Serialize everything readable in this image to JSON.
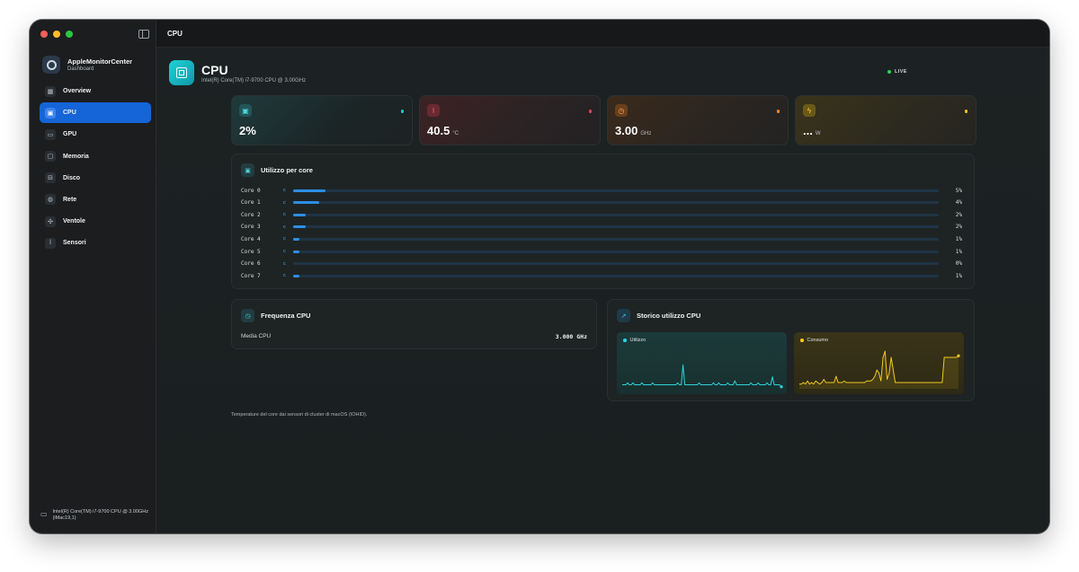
{
  "app": {
    "name": "AppleMonitorCenter",
    "subtitle": "Dashboard"
  },
  "sidebar": {
    "items": [
      {
        "label": "Overview",
        "icon": "grid-icon",
        "glyph": "▦",
        "active": false
      },
      {
        "label": "CPU",
        "icon": "chip-icon",
        "glyph": "▣",
        "active": true
      },
      {
        "label": "GPU",
        "icon": "display-icon",
        "glyph": "▭",
        "active": false
      },
      {
        "label": "Memoria",
        "icon": "memory-icon",
        "glyph": "▢",
        "active": false
      },
      {
        "label": "Disco",
        "icon": "disk-icon",
        "glyph": "⊟",
        "active": false
      },
      {
        "label": "Rete",
        "icon": "globe-icon",
        "glyph": "◍",
        "active": false
      },
      {
        "label": "Ventole",
        "icon": "fan-icon",
        "glyph": "✣",
        "active": false
      },
      {
        "label": "Sensori",
        "icon": "thermometer-icon",
        "glyph": "ǀ",
        "active": false
      }
    ],
    "footer": "Intel(R) Core(TM) i7-9700 CPU @ 3.00GHz (iMac19,1)"
  },
  "titlebar": {
    "title": "CPU"
  },
  "header": {
    "title": "CPU",
    "subtitle": "Intel(R) Core(TM) i7-9700 CPU @ 3.00GHz",
    "live": "LIVE"
  },
  "stats": [
    {
      "value": "2%",
      "unit": "",
      "icon": "chip-icon",
      "color": "#27c3c9"
    },
    {
      "value": "40.5",
      "unit": "°C",
      "icon": "thermometer-icon",
      "color": "#e8414f"
    },
    {
      "value": "3.00",
      "unit": "GHz",
      "icon": "clock-icon",
      "color": "#f08a2a"
    },
    {
      "value": "...",
      "unit": "W",
      "icon": "bolt-icon",
      "color": "#f2c21b"
    }
  ],
  "cores": {
    "title": "Utilizzo per core",
    "rows": [
      {
        "label": "Core 0",
        "marker": "c",
        "pct": 5,
        "text": "5%"
      },
      {
        "label": "Core 1",
        "marker": "c",
        "pct": 4,
        "text": "4%"
      },
      {
        "label": "Core 2",
        "marker": "c",
        "pct": 2,
        "text": "2%"
      },
      {
        "label": "Core 3",
        "marker": "c",
        "pct": 2,
        "text": "2%"
      },
      {
        "label": "Core 4",
        "marker": "c",
        "pct": 1,
        "text": "1%"
      },
      {
        "label": "Core 5",
        "marker": "c",
        "pct": 1,
        "text": "1%"
      },
      {
        "label": "Core 6",
        "marker": "c",
        "pct": 0,
        "text": "0%"
      },
      {
        "label": "Core 7",
        "marker": "c",
        "pct": 1,
        "text": "1%"
      }
    ]
  },
  "frequency": {
    "title": "Frequenza CPU",
    "label": "Media CPU",
    "value": "3.000 GHz"
  },
  "history": {
    "title": "Storico utilizzo CPU",
    "usage_label": "Utilizzo",
    "power_label": "Consumo",
    "usage_color": "#2ed3da",
    "power_color": "#f2c91f",
    "usage_series": [
      2,
      2,
      2,
      3,
      2,
      2,
      3,
      2,
      2,
      2,
      2,
      3,
      2,
      2,
      2,
      2,
      2,
      3,
      2,
      2,
      2,
      2,
      2,
      2,
      2,
      2,
      2,
      2,
      2,
      2,
      2,
      3,
      2,
      2,
      12,
      2,
      2,
      2,
      2,
      2,
      2,
      2,
      2,
      3,
      2,
      2,
      2,
      2,
      2,
      2,
      2,
      3,
      2,
      2,
      3,
      2,
      2,
      2,
      2,
      3,
      2,
      2,
      2,
      4,
      2,
      2,
      2,
      2,
      2,
      2,
      2,
      2,
      3,
      2,
      2,
      2,
      3,
      2,
      2,
      2,
      2,
      3,
      2,
      2,
      6,
      2,
      2,
      2,
      2,
      1
    ],
    "power_series": [
      3,
      3,
      4,
      3,
      5,
      3,
      4,
      3,
      5,
      4,
      3,
      4,
      6,
      4,
      4,
      4,
      4,
      4,
      8,
      4,
      4,
      4,
      5,
      4,
      4,
      4,
      4,
      4,
      4,
      4,
      4,
      4,
      4,
      5,
      5,
      5,
      6,
      8,
      12,
      10,
      5,
      20,
      24,
      6,
      10,
      20,
      12,
      4,
      4,
      4,
      4,
      4,
      4,
      4,
      4,
      4,
      4,
      4,
      4,
      4,
      4,
      4,
      4,
      4,
      4,
      4,
      4,
      4,
      4,
      4,
      4,
      20,
      20,
      20,
      20,
      20,
      20,
      20,
      21
    ]
  },
  "footnote": "Temperature del core dai sensori di cluster di macOS (IOHID)."
}
